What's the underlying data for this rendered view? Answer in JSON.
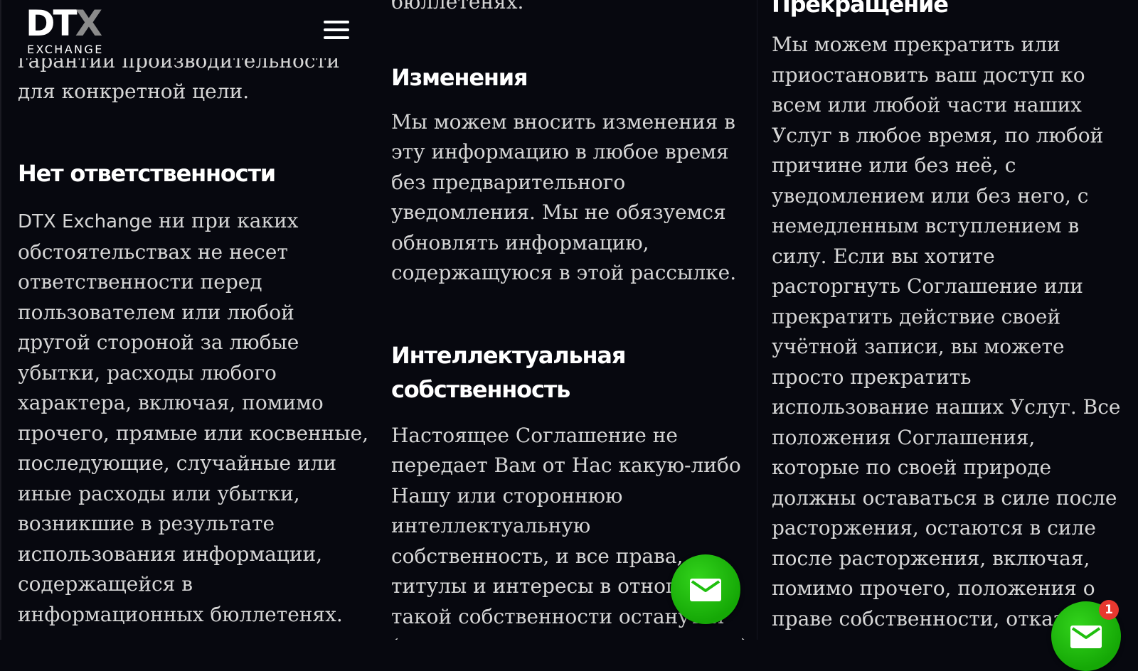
{
  "header": {
    "logo_main": "DT",
    "logo_x": "X",
    "logo_sub": "EXCHANGE",
    "menu_icon": "hamburger-menu-icon"
  },
  "col1": {
    "intro_text": "гарантии производительности для конкретной цели.",
    "section_heading": "Нет ответственности",
    "section_lead": "DTX Exchange",
    "section_body": " ни при каких обстоятельствах не несет ответственности перед пользователем или любой другой стороной за любые убытки, расходы любого характера, включая, помимо прочего, прямые или косвенные, последующие, случайные или иные расходы или убытки, возникшие в результате использования информации, содержащейся в информационных бюллетенях."
  },
  "col2": {
    "intro_text": "бюллетенях.",
    "changes_heading": "Изменения",
    "changes_body": "Мы можем вносить изменения в эту информацию в любое время без предварительного уведомления. Мы не обязуемся обновлять информацию, содержащуюся в этой рассылке.",
    "ip_heading": "Интеллектуальная собственность",
    "ip_body": "Настоящее Соглашение не передает Вам от Нас какую-либо Нашу или стороннюю интеллектуальную собственность, и все права, титулы и интересы в отношении такой собственности останутся (в отношениях между сторонами)"
  },
  "col3": {
    "heading": "Прекращение",
    "body": "Мы можем прекратить или приостановить ваш доступ ко всем или любой части наших Услуг в любое время, по любой причине или без неё, с уведомлением или без него, с немедленным вступлением в силу. Если вы хотите расторгнуть Соглашение или прекратить действие своей учётной записи, вы можете просто прекратить использование наших Услуг. Все положения Соглашения, которые по своей природе должны оставаться в силе после расторжения, остаются в силе после расторжения, включая, помимо прочего, положения о праве собственности, отказ от гарантийных обязательств, возмещение убытков и"
  },
  "fab": {
    "icon": "mail-icon",
    "badge_count": "1",
    "color": "#1fbf0e"
  }
}
